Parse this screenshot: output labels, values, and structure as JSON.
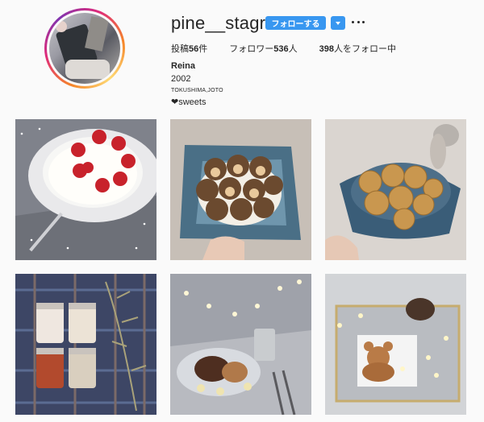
{
  "profile": {
    "username": "pine__stagram",
    "follow_label": "フォローする",
    "posts_prefix": "投稿",
    "posts_count": "56",
    "posts_suffix": "件",
    "followers_prefix": "フォロワー",
    "followers_count": "536",
    "followers_suffix": "人",
    "following_count": "398",
    "following_suffix": "人をフォロー中"
  },
  "bio": {
    "name": "Reina",
    "year": "2002",
    "location": "TOKUSHIMA,JOTO",
    "tagline": "❤sweets"
  },
  "icons": {
    "dropdown": "chevron-down-icon",
    "more": "more-options-icon"
  },
  "colors": {
    "accent": "#3897f0",
    "ring_start": "#f58529",
    "ring_end": "#dd2a7b"
  },
  "posts": [
    {
      "subject": "strawberry cake"
    },
    {
      "subject": "bear cookies on blue napkin"
    },
    {
      "subject": "cookies in bowl"
    },
    {
      "subject": "jam jars on plaid"
    },
    {
      "subject": "pancakes with fairy lights"
    },
    {
      "subject": "bear pancake with fairy lights"
    }
  ]
}
